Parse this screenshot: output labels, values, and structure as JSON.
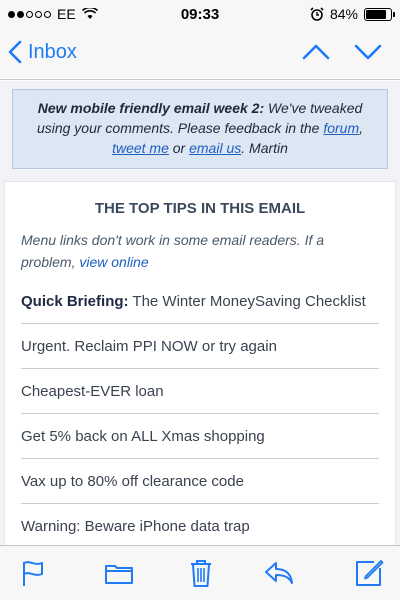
{
  "status_bar": {
    "carrier": "EE",
    "time": "09:33",
    "battery": "84%",
    "battery_level": 0.84
  },
  "nav": {
    "back_label": "Inbox"
  },
  "notice": {
    "bold": "New mobile friendly email week 2:",
    "text": " We've tweaked using your comments. Please feedback in the ",
    "link_forum": "forum",
    "sep1": ", ",
    "link_tweet": "tweet me",
    "sep2": " or ",
    "link_email": "email us",
    "end": ". Martin"
  },
  "card": {
    "title": "THE TOP TIPS IN THIS EMAIL",
    "sub_text": "Menu links don't work in some email readers. If a problem, ",
    "sub_link": "view online",
    "briefing_bold": "Quick Briefing:",
    "briefing_text": " The Winter MoneySaving Checklist",
    "tips": [
      "Urgent. Reclaim PPI NOW or try again",
      "Cheapest-EVER loan",
      "Get 5% back on ALL Xmas shopping",
      "Vax up to 80% off clearance code",
      "Warning: Beware iPhone data trap"
    ]
  },
  "icons": {
    "flag": "flag-icon",
    "folder": "folder-icon",
    "trash": "trash-icon",
    "reply": "reply-icon",
    "compose": "compose-icon"
  },
  "colors": {
    "accent": "#1f7bf6",
    "notice_bg": "#dde6f3",
    "link": "#1f5fbf"
  }
}
